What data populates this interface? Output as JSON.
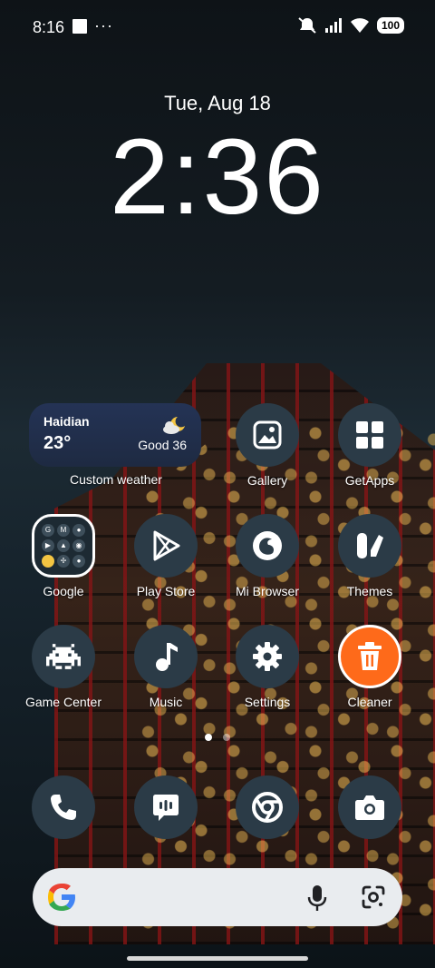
{
  "status_bar": {
    "time": "8:16",
    "dots": "···",
    "battery": "100"
  },
  "lock_clock": {
    "date": "Tue, Aug 18",
    "time": "2:36"
  },
  "weather_widget": {
    "city": "Haidian",
    "temperature": "23°",
    "air_quality": "Good 36",
    "label": "Custom weather"
  },
  "apps": {
    "gallery": "Gallery",
    "getapps": "GetApps",
    "google": "Google",
    "play_store": "Play Store",
    "mi_browser": "Mi Browser",
    "themes": "Themes",
    "game_center": "Game Center",
    "music": "Music",
    "settings": "Settings",
    "cleaner": "Cleaner"
  },
  "page_indicator": {
    "pages": 2,
    "current": 1
  },
  "colors": {
    "icon_bg": "#2b3b47",
    "cleaner_accent": "#fe6a1a",
    "weather_bg": "#243355"
  }
}
